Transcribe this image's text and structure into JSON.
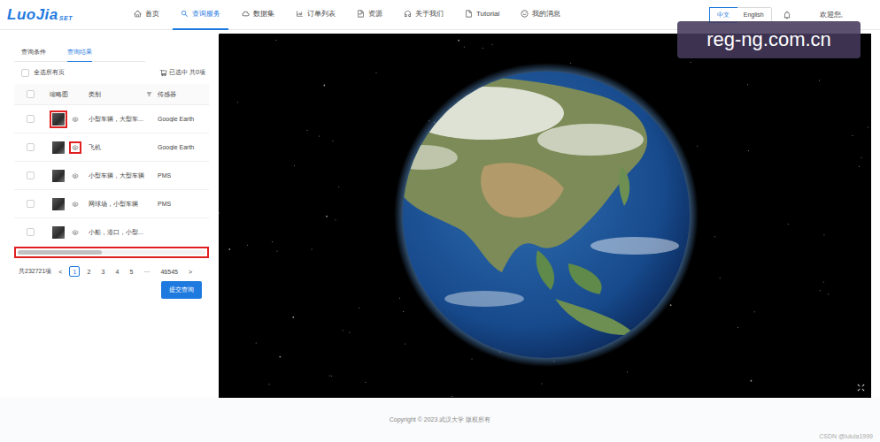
{
  "logo": {
    "main": "LuoJia",
    "sub": "SET"
  },
  "nav": [
    {
      "label": "首页",
      "icon": "home",
      "selected": false
    },
    {
      "label": "查询服务",
      "icon": "search",
      "selected": true
    },
    {
      "label": "数据集",
      "icon": "cloud",
      "selected": false
    },
    {
      "label": "订单列表",
      "icon": "chart",
      "selected": false
    },
    {
      "label": "资源",
      "icon": "doc",
      "selected": false
    },
    {
      "label": "关于我们",
      "icon": "headset",
      "selected": false
    },
    {
      "label": "Tutorial",
      "icon": "file",
      "selected": false
    },
    {
      "label": "我的消息",
      "icon": "smile",
      "selected": false
    }
  ],
  "languages": [
    {
      "label": "中文",
      "selected": true
    },
    {
      "label": "English",
      "selected": false
    }
  ],
  "welcome": "欢迎您,",
  "watermark": "reg-ng.com.cn",
  "panel": {
    "tabs": [
      {
        "label": "查询条件",
        "selected": false
      },
      {
        "label": "查询结果",
        "selected": true
      }
    ],
    "select_all": {
      "label": "全选所有页",
      "checked": false
    },
    "cart": "已选中 共0项",
    "columns": [
      "缩略图",
      "类别",
      "传感器"
    ],
    "rows": [
      {
        "category": "小型车辆，大型车...",
        "sensor": "Google Earth",
        "checked": false,
        "highlight": "thumbnail"
      },
      {
        "category": "飞机",
        "sensor": "Google Earth",
        "checked": false,
        "highlight": "eye"
      },
      {
        "category": "小型车辆，大型车辆",
        "sensor": "PMS",
        "checked": false,
        "highlight": "none"
      },
      {
        "category": "网球场，小型车辆",
        "sensor": "PMS",
        "checked": false,
        "highlight": "none"
      },
      {
        "category": "小船，港口，小型...",
        "sensor": "",
        "checked": false,
        "highlight": "none"
      }
    ],
    "scrollbar": {
      "level": 0.45,
      "highlighted": true
    },
    "pagination": {
      "total": "共232721项",
      "prev": "<",
      "pages": [
        {
          "label": "1",
          "selected": true
        },
        {
          "label": "2",
          "selected": false
        },
        {
          "label": "3",
          "selected": false
        },
        {
          "label": "4",
          "selected": false
        },
        {
          "label": "5",
          "selected": false
        }
      ],
      "ellipsis": "···",
      "last": "46545",
      "next": ">"
    },
    "submit": "提交查询"
  },
  "footer": "Copyright © 2023 武汉大学 版权所有",
  "credit": "CSDN @lulula1999"
}
